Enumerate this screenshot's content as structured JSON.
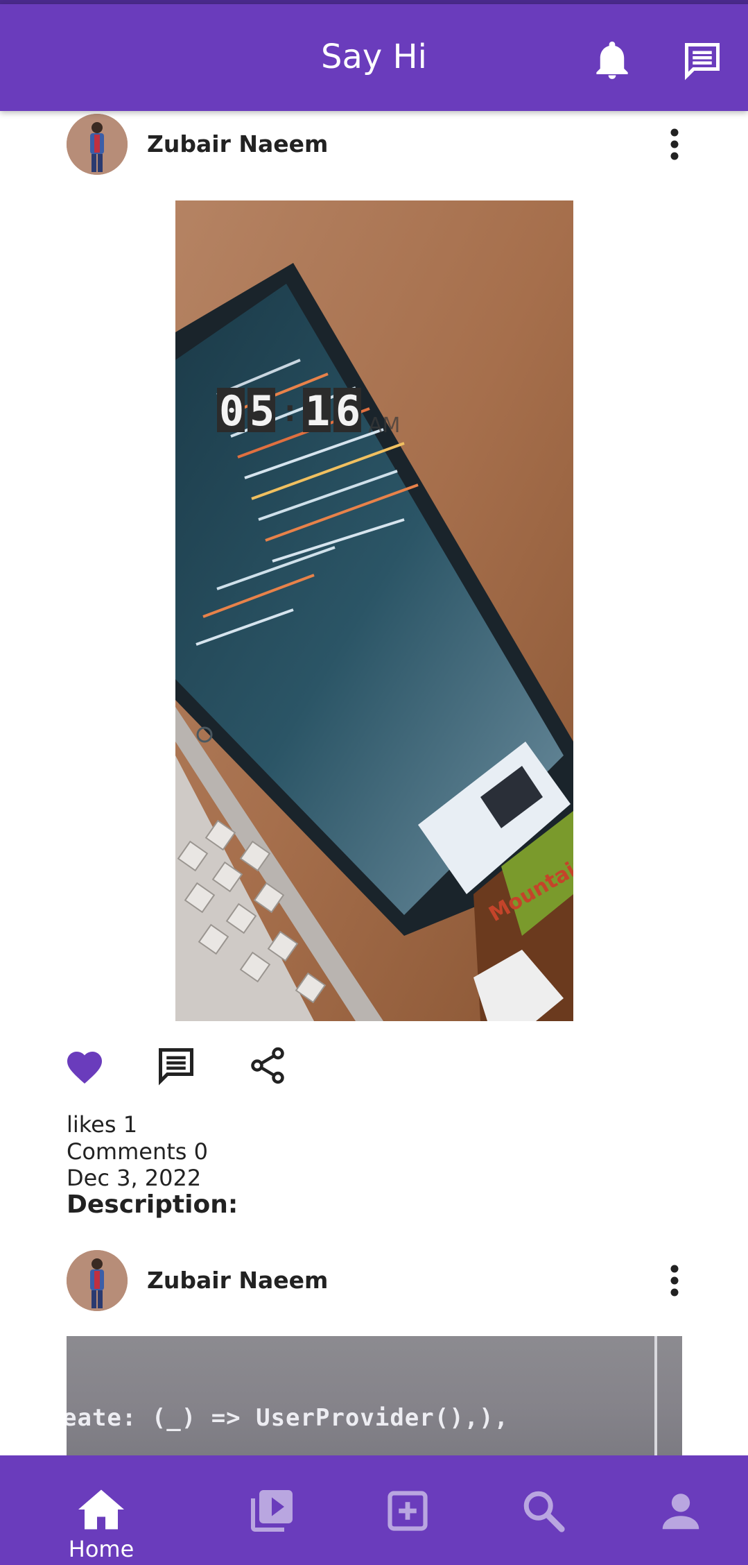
{
  "app": {
    "title": "Say Hi",
    "brand_color": "#6a3cbc",
    "like_color": "#6a3cbc"
  },
  "header": {
    "icons": [
      "bell-icon",
      "chat-icon"
    ]
  },
  "posts": [
    {
      "author": "Zubair Naeem",
      "image_desc_visible_text": {
        "clock": "05 : 16",
        "ampm": "AM"
      },
      "likes_label": "likes 1",
      "comments_label": "Comments 0",
      "date": "Dec 3, 2022",
      "description_label": "Description:"
    },
    {
      "author": "Zubair Naeem",
      "image_visible_text": "eate: (_) => UserProvider(),),"
    }
  ],
  "bottom_nav": {
    "items": [
      {
        "label": "Home",
        "icon": "home-icon",
        "active": true
      },
      {
        "label": "",
        "icon": "video-library-icon",
        "active": false
      },
      {
        "label": "",
        "icon": "add-box-icon",
        "active": false
      },
      {
        "label": "",
        "icon": "search-icon",
        "active": false
      },
      {
        "label": "",
        "icon": "person-icon",
        "active": false
      }
    ]
  }
}
